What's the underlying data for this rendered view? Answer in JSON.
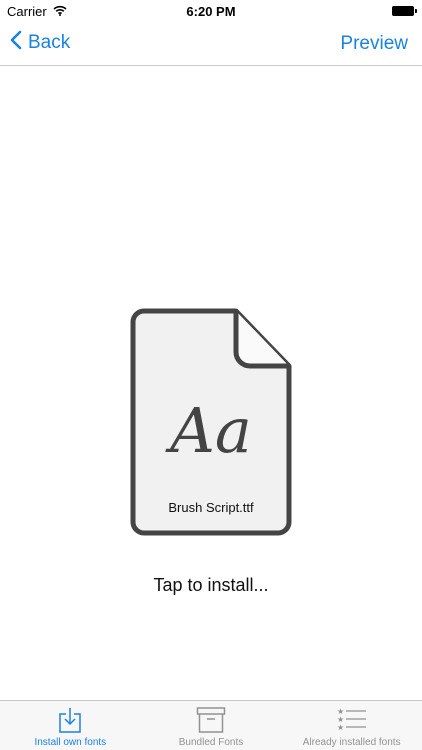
{
  "status_bar": {
    "carrier": "Carrier",
    "time": "6:20 PM"
  },
  "nav": {
    "back_label": "Back",
    "preview_label": "Preview"
  },
  "document": {
    "glyph": "Aa",
    "filename": "Brush Script.ttf"
  },
  "prompt": "Tap to install...",
  "tabs": [
    {
      "label": "Install own fonts",
      "icon": "download-tray-icon",
      "active": true
    },
    {
      "label": "Bundled Fonts",
      "icon": "archive-box-icon",
      "active": false
    },
    {
      "label": "Already installed fonts",
      "icon": "starred-list-icon",
      "active": false
    }
  ],
  "colors": {
    "accent": "#1a82e2",
    "inactive_tab": "#929292",
    "document_border": "#444444",
    "document_fill": "#f1f1f1"
  }
}
